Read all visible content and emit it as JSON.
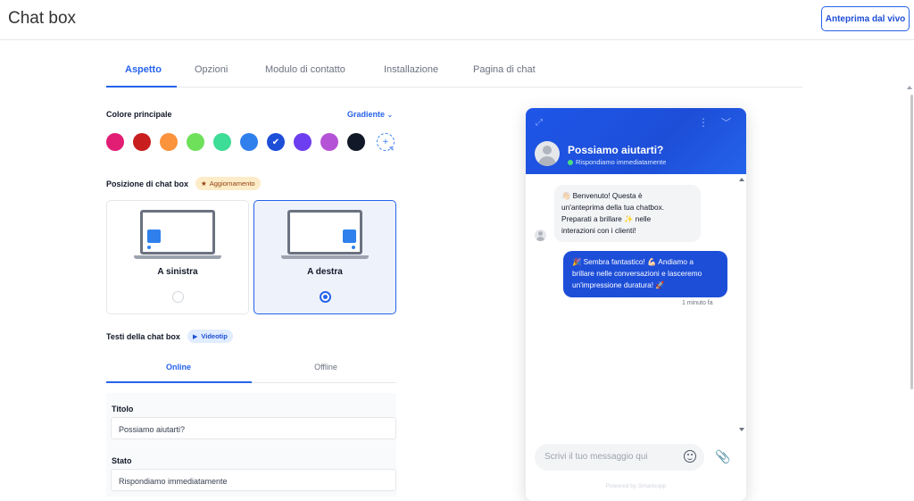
{
  "header": {
    "title": "Chat box",
    "live_preview": "Anteprima dal vivo"
  },
  "tabs": [
    {
      "label": "Aspetto",
      "active": true
    },
    {
      "label": "Opzioni"
    },
    {
      "label": "Modulo di contatto"
    },
    {
      "label": "Installazione"
    },
    {
      "label": "Pagina di chat"
    }
  ],
  "color_section": {
    "label": "Colore principale",
    "gradient_link": "Gradiente",
    "swatches": [
      "#e11d74",
      "#c81e1e",
      "#fb923c",
      "#6ee05a",
      "#3ddc97",
      "#2f80ed",
      "#1d4ed8",
      "#6d3df0",
      "#b553d6",
      "#111827"
    ],
    "selected_index": 6
  },
  "position_section": {
    "label": "Posizione di chat box",
    "badge": "Aggiornamento",
    "options": [
      {
        "label": "A sinistra",
        "selected": false
      },
      {
        "label": "A destra",
        "selected": true
      }
    ]
  },
  "texts_section": {
    "label": "Testi della chat box",
    "badge": "Videotip",
    "subtabs": [
      {
        "label": "Online",
        "active": true
      },
      {
        "label": "Offline"
      }
    ],
    "title_label": "Titolo",
    "title_value": "Possiamo aiutarti?",
    "status_label": "Stato",
    "status_value": "Rispondiamo immediatamente"
  },
  "chat_preview": {
    "title": "Possiamo aiutarti?",
    "status": "Rispondiamo immediatamente",
    "bot_message_lines": [
      "👋🏻 Benvenuto! Questa è",
      "un'anteprima della tua chatbox.",
      "Preparati a brillare ✨ nelle",
      "interazioni con i clienti!"
    ],
    "user_message_lines": [
      "🎉 Sembra fantastico! 💪🏻 Andiamo a",
      "brillare nelle conversazioni e lasceremo",
      "un'impressione duratura! 🚀"
    ],
    "timestamp": "1 minuto fa",
    "input_placeholder": "Scrivi il tuo messaggio qui",
    "powered_by": "Powered by Smartsupp"
  }
}
